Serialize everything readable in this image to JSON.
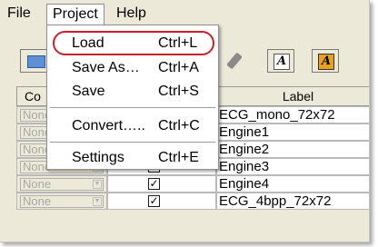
{
  "menubar": {
    "file": "File",
    "project": "Project",
    "help": "Help"
  },
  "project_menu": {
    "items": [
      {
        "label": "Load",
        "shortcut": "Ctrl+L",
        "highlighted": true
      },
      {
        "label": "Save As…",
        "shortcut": "Ctrl+A"
      },
      {
        "label": "Save",
        "shortcut": "Ctrl+S"
      },
      {
        "label": "Convert…..",
        "shortcut": "Ctrl+C"
      },
      {
        "label": "Settings",
        "shortcut": "Ctrl+E"
      }
    ],
    "highlight_color": "#c8202a"
  },
  "toolbar": {
    "icons": [
      "open-folder-icon",
      "wrench-icon",
      "text-a-icon",
      "text-a-orange-icon"
    ]
  },
  "table": {
    "headers": [
      "Co",
      "",
      "Label"
    ],
    "rows": [
      {
        "combo": "None",
        "checked": true,
        "label": "ECG_mono_72x72"
      },
      {
        "combo": "None",
        "checked": true,
        "label": "Engine1"
      },
      {
        "combo": "None",
        "checked": true,
        "label": "Engine2"
      },
      {
        "combo": "None",
        "checked": true,
        "label": "Engine3"
      },
      {
        "combo": "None",
        "checked": true,
        "label": "Engine4"
      },
      {
        "combo": "None",
        "checked": true,
        "label": "ECG_4bpp_72x72"
      }
    ],
    "check_glyph": "✓"
  }
}
